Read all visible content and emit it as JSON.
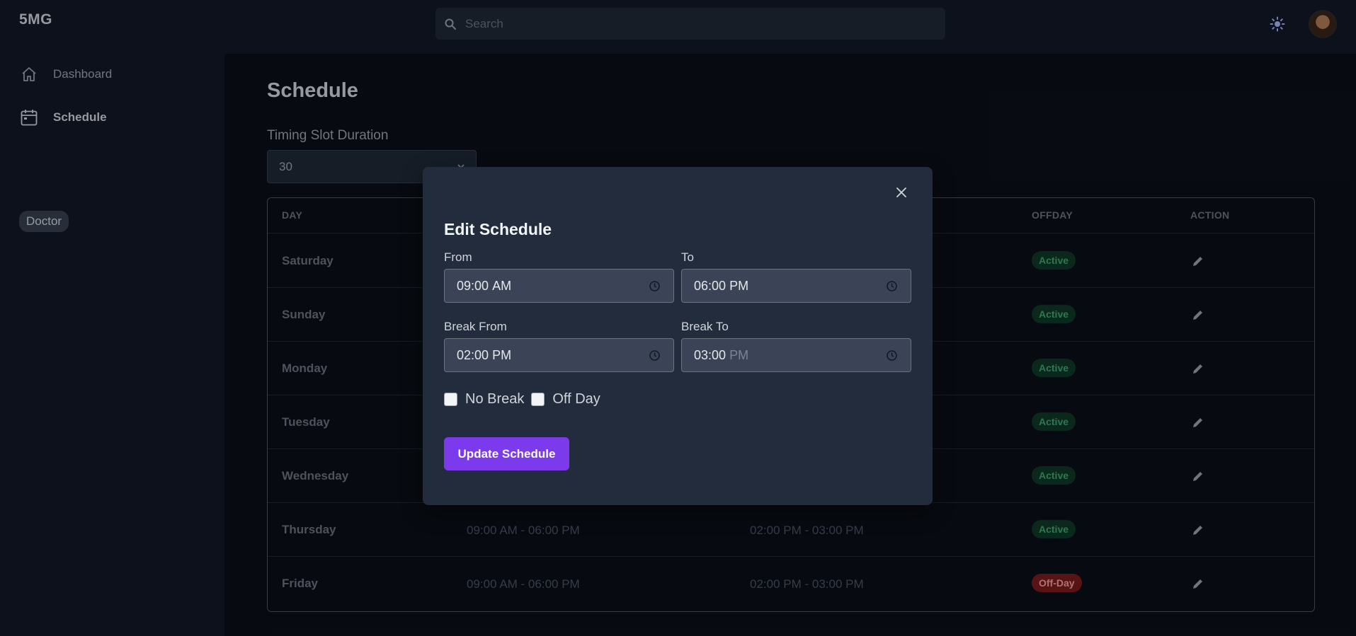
{
  "app": {
    "logo": "5MG",
    "search_placeholder": "Search"
  },
  "sidebar": {
    "items": [
      {
        "label": "Dashboard",
        "icon": "home-icon"
      },
      {
        "label": "Schedule",
        "icon": "calendar-icon"
      }
    ],
    "role": "Doctor"
  },
  "main": {
    "title": "Schedule",
    "slot_label": "Timing Slot Duration",
    "slot_value": "30",
    "table": {
      "headers": [
        "DAY",
        "OFFDAY",
        "ACTION"
      ],
      "rows": [
        {
          "day": "Saturday",
          "time": "",
          "break": "",
          "status": "Active"
        },
        {
          "day": "Sunday",
          "time": "",
          "break": "",
          "status": "Active"
        },
        {
          "day": "Monday",
          "time": "",
          "break": "",
          "status": "Active"
        },
        {
          "day": "Tuesday",
          "time": "",
          "break": "",
          "status": "Active"
        },
        {
          "day": "Wednesday",
          "time": "",
          "break": "",
          "status": "Active"
        },
        {
          "day": "Thursday",
          "time": "09:00 AM - 06:00 PM",
          "break": "02:00 PM - 03:00 PM",
          "status": "Active"
        },
        {
          "day": "Friday",
          "time": "09:00 AM - 06:00 PM",
          "break": "02:00 PM - 03:00 PM",
          "status": "Off-Day"
        }
      ]
    }
  },
  "modal": {
    "title": "Edit Schedule",
    "from_label": "From",
    "from_time": "09:00",
    "from_period": "AM",
    "to_label": "To",
    "to_time": "06:00",
    "to_period": "PM",
    "break_from_label": "Break From",
    "break_from_time": "02:00",
    "break_from_period": "PM",
    "break_to_label": "Break To",
    "break_to_time": "03:00",
    "break_to_period": "PM",
    "no_break_label": "No Break",
    "off_day_label": "Off Day",
    "update_label": "Update Schedule"
  },
  "colors": {
    "accent": "#7c3aed",
    "active_badge": "#0f3a28",
    "offday_badge": "#7a1c1c"
  }
}
